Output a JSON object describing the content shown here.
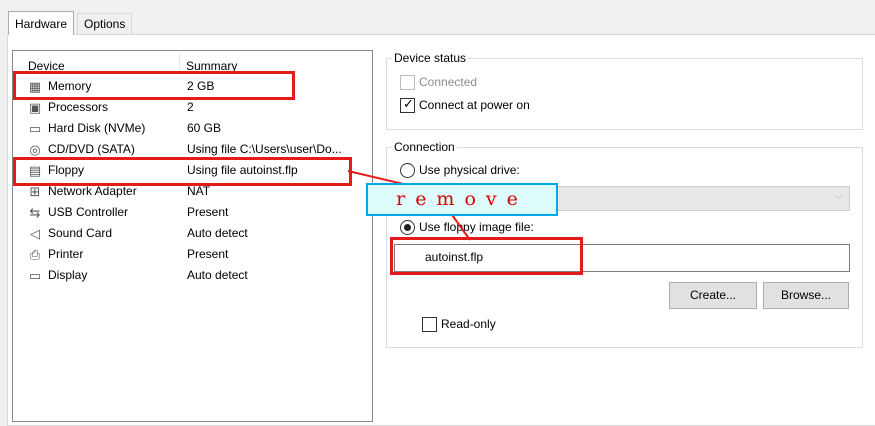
{
  "tabs": [
    {
      "label": "Hardware"
    },
    {
      "label": "Options"
    }
  ],
  "device_list": {
    "col_device": "Device",
    "col_summary": "Summary",
    "rows": [
      {
        "name": "Memory",
        "summary": "2 GB",
        "icon": "memory-icon"
      },
      {
        "name": "Processors",
        "summary": "2",
        "icon": "processor-icon"
      },
      {
        "name": "Hard Disk (NVMe)",
        "summary": "60 GB",
        "icon": "hard-disk-icon"
      },
      {
        "name": "CD/DVD (SATA)",
        "summary": "Using file C:\\Users\\user\\Do...",
        "icon": "cd-dvd-icon"
      },
      {
        "name": "Floppy",
        "summary": "Using file autoinst.flp",
        "icon": "floppy-icon"
      },
      {
        "name": "Network Adapter",
        "summary": "NAT",
        "icon": "network-adapter-icon"
      },
      {
        "name": "USB Controller",
        "summary": "Present",
        "icon": "usb-icon"
      },
      {
        "name": "Sound Card",
        "summary": "Auto detect",
        "icon": "speaker-icon"
      },
      {
        "name": "Printer",
        "summary": "Present",
        "icon": "printer-icon"
      },
      {
        "name": "Display",
        "summary": "Auto detect",
        "icon": "display-icon"
      }
    ]
  },
  "device_status": {
    "title": "Device status",
    "connected": {
      "label": "Connected",
      "checked": false,
      "enabled": false
    },
    "connect_power_on": {
      "label": "Connect at power on",
      "checked": true
    }
  },
  "connection": {
    "title": "Connection",
    "physical_drive": {
      "label": "Use physical drive:",
      "selected": false
    },
    "physical_drive_value": "",
    "floppy_image": {
      "label": "Use floppy image file:",
      "selected": true
    },
    "floppy_image_value": "autoinst.flp",
    "create_button": "Create...",
    "browse_button": "Browse...",
    "read_only": {
      "label": "Read-only",
      "checked": false
    }
  },
  "annotation": {
    "text": "remove",
    "highlight_color": "#e31b1b",
    "note_background": "#dffcfc"
  }
}
